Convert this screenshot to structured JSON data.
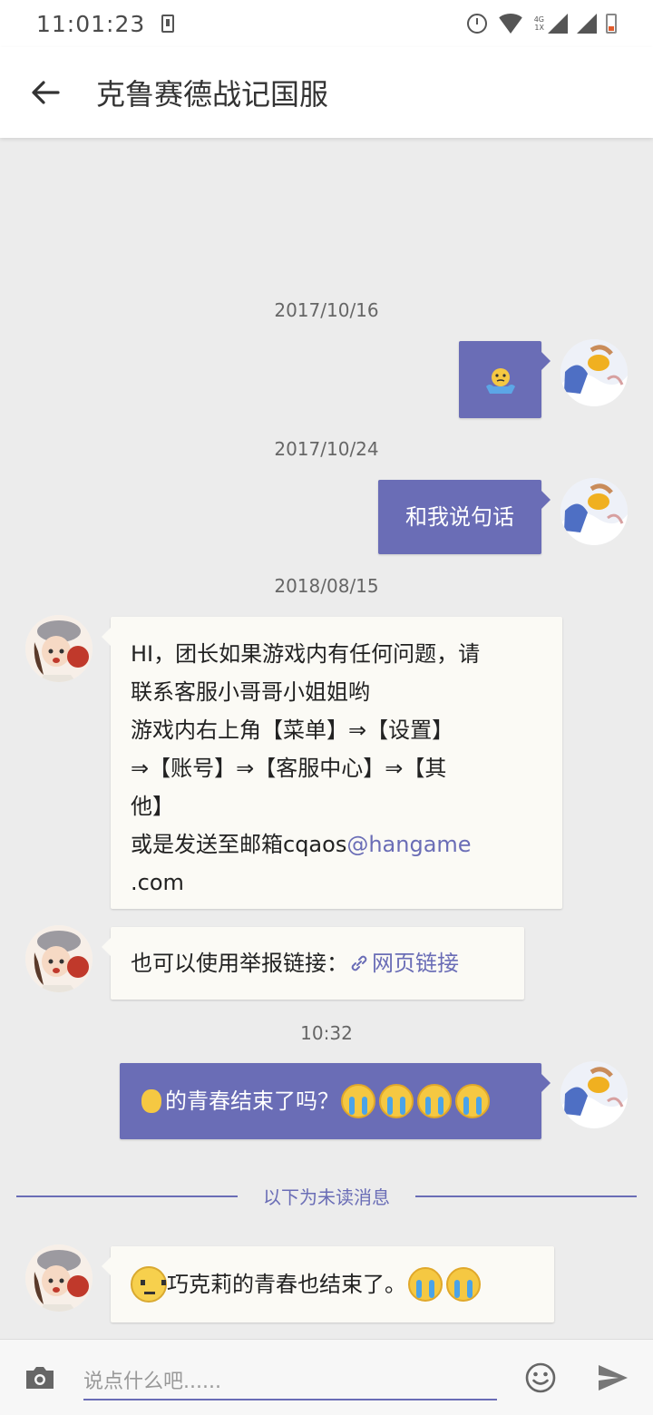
{
  "status_bar": {
    "time": "11:01:23",
    "network_type": "4G",
    "network_sub": "1X"
  },
  "app_bar": {
    "title": "克鲁赛德战记国服"
  },
  "chat": {
    "dates": {
      "d1": "2017/10/16",
      "d2": "2017/10/24",
      "d3": "2018/08/15",
      "d4": "10:32"
    },
    "messages": {
      "m2_text": "和我说句话",
      "m3_line1": "HI，团长如果游戏内有任何问题，请",
      "m3_line2": "联系客服小哥哥小姐姐哟",
      "m3_line3": "游戏内右上角【菜单】⇒【设置】",
      "m3_line4": "⇒【账号】⇒【客服中心】⇒【其",
      "m3_line5": "他】",
      "m3_line6_prefix": "或是发送至邮箱cqaos",
      "m3_line6_link": "@hangame",
      "m3_line7": ".com",
      "m4_prefix": "也可以使用举报链接：",
      "m4_link": "网页链接",
      "m5_text": "的青春结束了吗？",
      "m6_text": " 巧克莉的青春也结束了。"
    },
    "unread_label": "以下为未读消息"
  },
  "input_bar": {
    "placeholder": "说点什么吧......"
  },
  "colors": {
    "accent": "#6a6db6",
    "background": "#ececec",
    "incoming_bubble": "#fbfaf5"
  },
  "icons": {
    "back": "arrow-left-icon",
    "camera": "camera-icon",
    "emoji": "smiley-icon",
    "send": "send-icon",
    "link": "link-icon"
  }
}
